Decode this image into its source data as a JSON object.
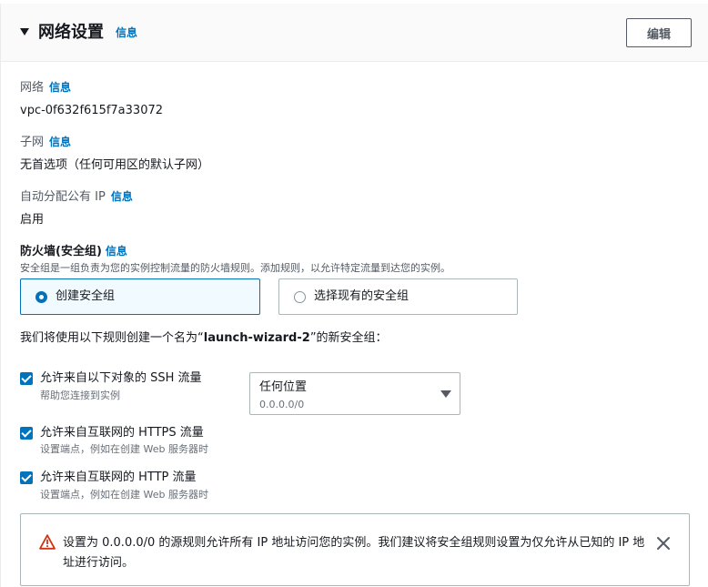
{
  "section": {
    "title": "网络设置",
    "info_link": "信息",
    "edit_label": "编辑"
  },
  "network": {
    "label": "网络",
    "info_link": "信息",
    "value": "vpc-0f632f615f7a33072"
  },
  "subnet": {
    "label": "子网",
    "info_link": "信息",
    "value": "无首选项（任何可用区的默认子网）"
  },
  "public_ip": {
    "label": "自动分配公有 IP",
    "info_link": "信息",
    "value": "启用"
  },
  "firewall": {
    "label": "防火墙(安全组)",
    "info_link": "信息",
    "description": "安全组是一组负责为您的实例控制流量的防火墙规则。添加规则，以允许特定流量到达您的实例。",
    "options": [
      {
        "label": "创建安全组",
        "selected": true
      },
      {
        "label": "选择现有的安全组",
        "selected": false
      }
    ],
    "rules_intro_prefix": "我们将使用以下规则创建一个名为“",
    "rules_intro_name": "launch-wizard-2",
    "rules_intro_suffix": "”的新安全组："
  },
  "rules": [
    {
      "label": "允许来自以下对象的 SSH 流量",
      "description": "帮助您连接到实例",
      "checked": true
    },
    {
      "label": "允许来自互联网的 HTTPS 流量",
      "description": "设置端点，例如在创建 Web 服务器时",
      "checked": true
    },
    {
      "label": "允许来自互联网的 HTTP 流量",
      "description": "设置端点，例如在创建 Web 服务器时",
      "checked": true
    }
  ],
  "ssh_source": {
    "selected": "任何位置",
    "cidr": "0.0.0.0/0"
  },
  "alert": {
    "icon": "warning-icon",
    "text": "设置为 0.0.0.0/0 的源规则允许所有 IP 地址访问您的实例。我们建议将安全组规则设置为仅允许从已知的 IP 地址进行访问。"
  },
  "colors": {
    "accent": "#0073bb",
    "warning": "#d13212",
    "text": "#16191f",
    "muted": "#545b64"
  }
}
